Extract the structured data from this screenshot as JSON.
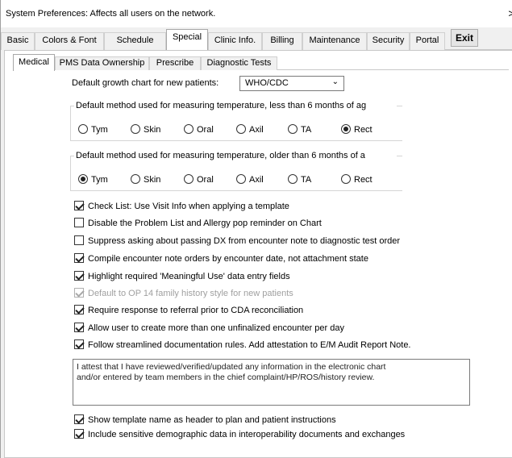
{
  "window": {
    "title": "System Preferences: Affects all users on the network.",
    "close_glyph": ">"
  },
  "main_tabs": [
    "Basic",
    "Colors & Font",
    "Schedule",
    "Special",
    "Clinic Info.",
    "Billing",
    "Maintenance",
    "Security",
    "Portal"
  ],
  "active_main_tab": "Special",
  "exit_label": "Exit",
  "sub_tabs": [
    "Medical",
    "PMS Data Ownership",
    "Prescribe",
    "Diagnostic Tests"
  ],
  "active_sub_tab": "Medical",
  "growth_chart": {
    "label": "Default growth chart for new patients:",
    "value": "WHO/CDC"
  },
  "temp_under6": {
    "legend": "Default method used for measuring temperature, less than 6 months of ag",
    "options": [
      "Tym",
      "Skin",
      "Oral",
      "Axil",
      "TA",
      "Rect"
    ],
    "selected": "Rect"
  },
  "temp_over6": {
    "legend": "Default method used for measuring temperature, older than 6 months of a",
    "options": [
      "Tym",
      "Skin",
      "Oral",
      "Axil",
      "TA",
      "Rect"
    ],
    "selected": "Tym"
  },
  "checkboxes": [
    {
      "label": "Check List: Use Visit Info when applying a template",
      "checked": true,
      "disabled": false
    },
    {
      "label": "Disable the Problem List and Allergy pop reminder on Chart",
      "checked": false,
      "disabled": false
    },
    {
      "label": "Suppress asking about passing DX from encounter note to diagnostic test order",
      "checked": false,
      "disabled": false
    },
    {
      "label": "Compile encounter note orders by encounter date, not attachment state",
      "checked": true,
      "disabled": false
    },
    {
      "label": "Highlight required 'Meaningful Use' data entry fields",
      "checked": true,
      "disabled": false
    },
    {
      "label": "Default to OP 14 family history style for new patients",
      "checked": true,
      "disabled": true
    },
    {
      "label": "Require response to referral prior to CDA reconciliation",
      "checked": true,
      "disabled": false
    },
    {
      "label": "Allow user to create more than one unfinalized encounter per day",
      "checked": true,
      "disabled": false
    },
    {
      "label": "Follow streamlined documentation rules.  Add attestation to E/M Audit Report Note.",
      "checked": true,
      "disabled": false
    }
  ],
  "attestation_text": "I attest that I have reviewed/verified/updated any information in the electronic chart\nand/or entered by team members in the chief complaint/HP/ROS/history review.",
  "bottom_checkboxes": [
    {
      "label": "Show template name as header to plan and patient instructions",
      "checked": true
    },
    {
      "label": "Include sensitive demographic data in interoperability documents and exchanges",
      "checked": true
    }
  ]
}
